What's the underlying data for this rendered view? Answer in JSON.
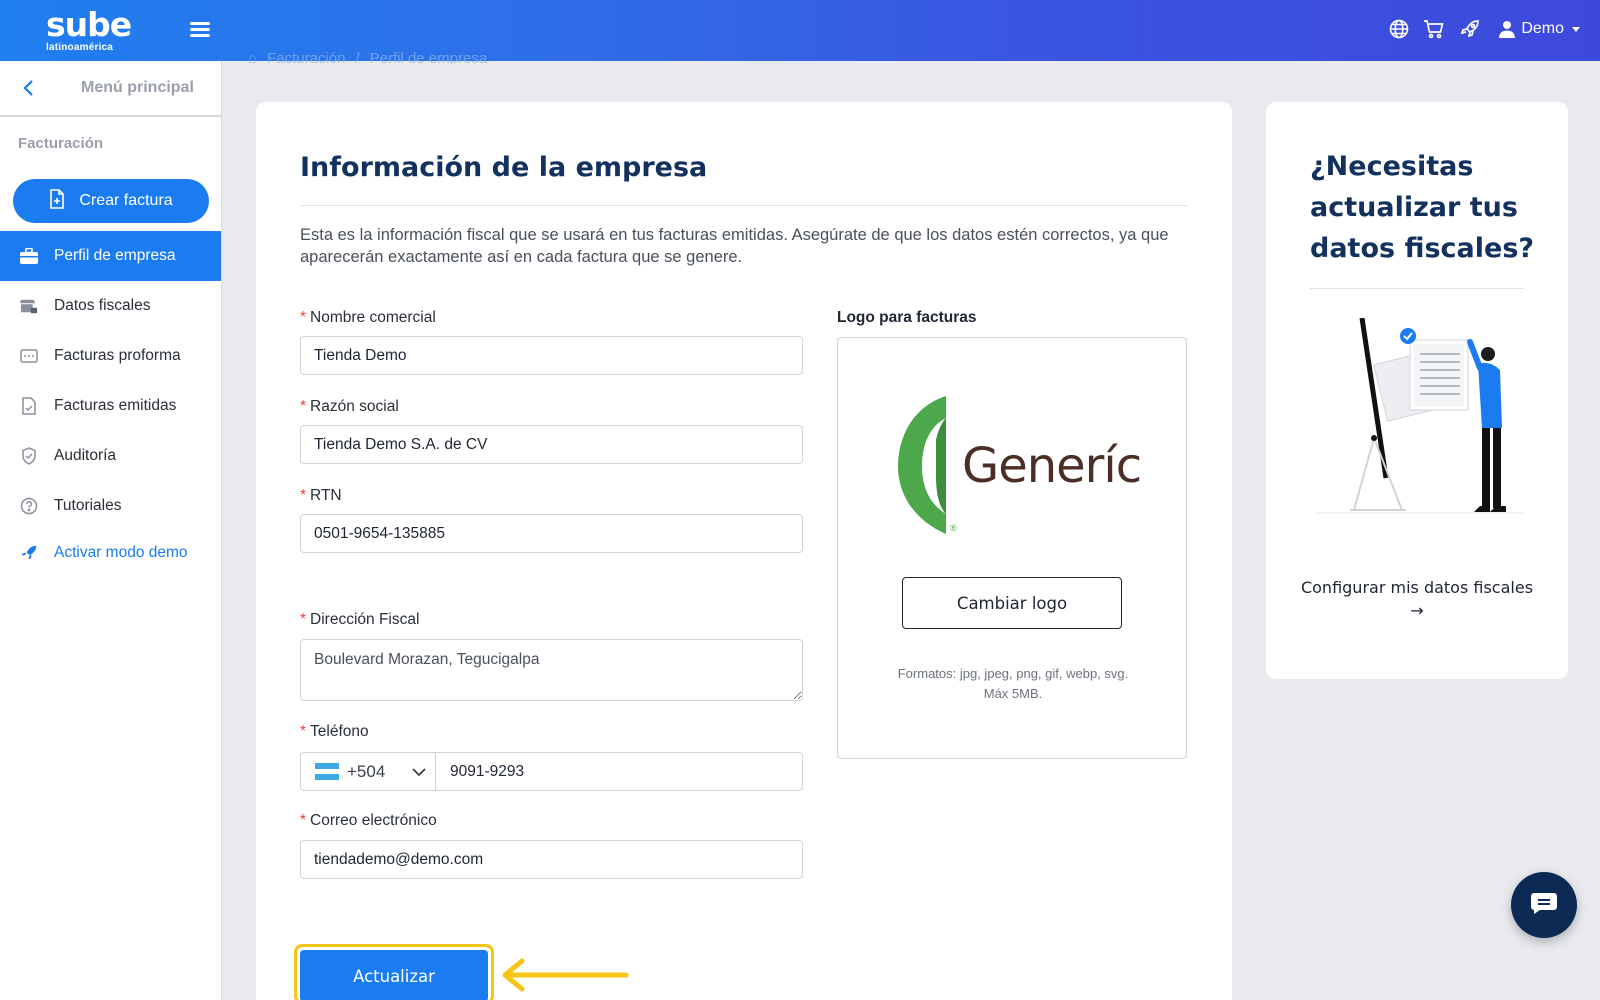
{
  "app": {
    "logo_main": "sube",
    "logo_sub": "latinoamérica",
    "user_name": "Demo"
  },
  "breadcrumb": [
    "Facturación",
    "/",
    "Perfil de empresa"
  ],
  "sidebar": {
    "back_label": "Menú principal",
    "section": "Facturación",
    "create_button": "Crear factura",
    "items": [
      {
        "label": "Perfil de empresa",
        "icon": "briefcase-icon",
        "active": true
      },
      {
        "label": "Datos fiscales",
        "icon": "store-lock-icon"
      },
      {
        "label": "Facturas proforma",
        "icon": "proforma-icon"
      },
      {
        "label": "Facturas emitidas",
        "icon": "document-check-icon"
      },
      {
        "label": "Auditoría",
        "icon": "shield-check-icon"
      },
      {
        "label": "Tutoriales",
        "icon": "help-circle-icon"
      }
    ],
    "demo_link": "Activar modo demo"
  },
  "form": {
    "title": "Información de la empresa",
    "description": "Esta es la información fiscal que se usará en tus facturas emitidas. Asegúrate de que los datos estén correctos, ya que aparecerán exactamente así en cada factura que se genere.",
    "required_mark": "*",
    "fields": {
      "nombre_comercial": {
        "label": "Nombre comercial",
        "value": "Tienda Demo"
      },
      "razon_social": {
        "label": "Razón social",
        "value": "Tienda Demo S.A. de CV"
      },
      "rtn": {
        "label": "RTN",
        "value": "0501-9654-135885"
      },
      "direccion": {
        "label": "Dirección Fiscal",
        "value": "Boulevard Morazan, Tegucigalpa"
      },
      "telefono": {
        "label": "Teléfono",
        "country_code": "+504",
        "value": "9091-9293"
      },
      "correo": {
        "label": "Correo electrónico",
        "value": "tiendademo@demo.com"
      }
    },
    "logo": {
      "label": "Logo para facturas",
      "brand_text": "Generíc",
      "brand_reg": "®",
      "change_button": "Cambiar logo",
      "formats_line1": "Formatos: jpg, jpeg, png, gif, webp, svg.",
      "formats_line2": "Máx 5MB."
    },
    "submit_button": "Actualizar"
  },
  "side_card": {
    "title": "¿Necesitas actualizar tus datos fiscales?",
    "link": "Configurar mis datos fiscales →"
  },
  "colors": {
    "primary": "#1a7cf0",
    "navy": "#12315e",
    "highlight": "#f5c518",
    "brand_green": "#4ca84a",
    "brand_brown": "#4b2e26"
  }
}
